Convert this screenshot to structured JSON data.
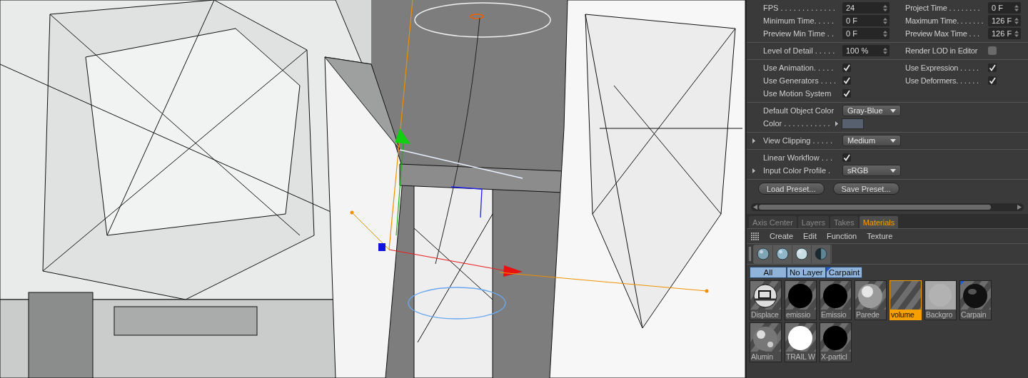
{
  "attributes": {
    "sections": [
      {
        "rows": [
          [
            {
              "kind": "spinner",
              "label": "FPS . . . . . . . . . . . . .",
              "value": "24"
            },
            {
              "kind": "spinner",
              "label": "Project Time . . . . . . . .",
              "value": "0 F"
            }
          ],
          [
            {
              "kind": "spinner",
              "label": "Minimum Time. . . . .",
              "value": "0 F"
            },
            {
              "kind": "spinner",
              "label": "Maximum Time. . . . . . .",
              "value": "126 F"
            }
          ],
          [
            {
              "kind": "spinner",
              "label": "Preview Min Time . .",
              "value": "0 F"
            },
            {
              "kind": "spinner",
              "label": "Preview Max Time . . .",
              "value": "126 F"
            }
          ]
        ]
      },
      {
        "rows": [
          [
            {
              "kind": "spinner",
              "label": "Level of Detail . . . . .",
              "value": "100 %"
            },
            {
              "kind": "checkbox",
              "label": "Render LOD in Editor",
              "checked": false
            }
          ]
        ]
      },
      {
        "rows": [
          [
            {
              "kind": "checkbox",
              "label": "Use Animation. . . . .",
              "checked": true
            },
            {
              "kind": "checkbox",
              "label": "Use Expression . . . . .",
              "checked": true
            }
          ],
          [
            {
              "kind": "checkbox",
              "label": "Use Generators . . . .",
              "checked": true
            },
            {
              "kind": "checkbox",
              "label": "Use Deformers. . . . . .",
              "checked": true
            }
          ],
          [
            {
              "kind": "checkbox",
              "label": "Use Motion System",
              "checked": true
            }
          ]
        ]
      },
      {
        "rows": [
          [
            {
              "kind": "dropdown",
              "label": "Default Object Color",
              "value": "Gray-Blue"
            }
          ],
          [
            {
              "kind": "swatch",
              "label": "Color . . . . . . . . . . .",
              "color": "#56606e"
            }
          ]
        ]
      },
      {
        "rows": [
          [
            {
              "kind": "dropdown",
              "label": "View Clipping . . . . .",
              "value": "Medium",
              "expander": true
            }
          ]
        ]
      },
      {
        "rows": [
          [
            {
              "kind": "checkbox",
              "label": "Linear Workflow . . .",
              "checked": true
            }
          ],
          [
            {
              "kind": "dropdown",
              "label": "Input Color Profile .",
              "value": "sRGB",
              "expander": true
            }
          ]
        ]
      }
    ],
    "buttons": [
      "Load Preset...",
      "Save Preset..."
    ]
  },
  "tabs": [
    {
      "label": "Axis Center",
      "selected": false
    },
    {
      "label": "Layers",
      "selected": false
    },
    {
      "label": "Takes",
      "selected": false
    },
    {
      "label": "Materials",
      "selected": true
    }
  ],
  "menu": [
    "Create",
    "Edit",
    "Function",
    "Texture"
  ],
  "layer_filters": [
    {
      "label": "All",
      "corner_mark": false
    },
    {
      "label": "No Layer",
      "corner_mark": false
    },
    {
      "label": "Carpaint",
      "corner_mark": true
    }
  ],
  "materials": [
    {
      "name": "Displace",
      "kind": "mottled",
      "selected": false,
      "corner_mark": false
    },
    {
      "name": "emissio",
      "kind": "black",
      "selected": false,
      "corner_mark": false
    },
    {
      "name": "Emissio",
      "kind": "black",
      "selected": false,
      "corner_mark": false
    },
    {
      "name": "Parede",
      "kind": "glossy",
      "selected": false,
      "corner_mark": false
    },
    {
      "name": "volume",
      "kind": "empty",
      "selected": true,
      "corner_mark": false
    },
    {
      "name": "Backgro",
      "kind": "noise",
      "selected": false,
      "corner_mark": false
    },
    {
      "name": "Carpain",
      "kind": "dark",
      "selected": false,
      "corner_mark": true
    },
    {
      "name": "Alumin",
      "kind": "metal",
      "selected": false,
      "corner_mark": false
    },
    {
      "name": "TRAIL W",
      "kind": "white",
      "selected": false,
      "corner_mark": false
    },
    {
      "name": "X-particl",
      "kind": "black",
      "selected": false,
      "corner_mark": false
    }
  ]
}
